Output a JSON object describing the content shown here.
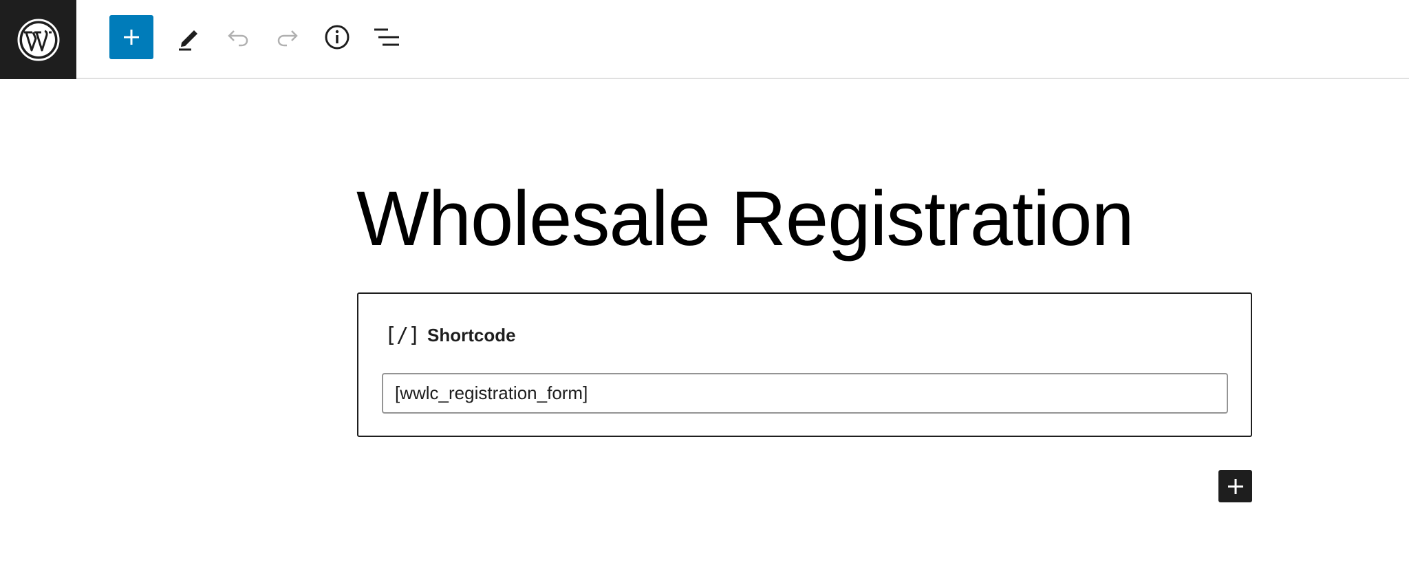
{
  "toolbar": {
    "logo_icon": "wordpress-logo-icon",
    "buttons": [
      {
        "name": "inserter-toggle",
        "icon": "plus-icon",
        "color": "#007cba"
      },
      {
        "name": "tools",
        "icon": "pencil-icon"
      },
      {
        "name": "undo",
        "icon": "undo-icon"
      },
      {
        "name": "redo",
        "icon": "redo-icon"
      },
      {
        "name": "details",
        "icon": "info-icon"
      },
      {
        "name": "list-view",
        "icon": "list-view-icon"
      }
    ]
  },
  "editor": {
    "post_title": "Wholesale Registration",
    "shortcode_block": {
      "icon_glyph": "[/]",
      "label": "Shortcode",
      "value": "[wwlc_registration_form]"
    },
    "appender_icon": "plus-icon"
  },
  "colors": {
    "accent": "#007cba",
    "dark": "#1e1e1e"
  }
}
